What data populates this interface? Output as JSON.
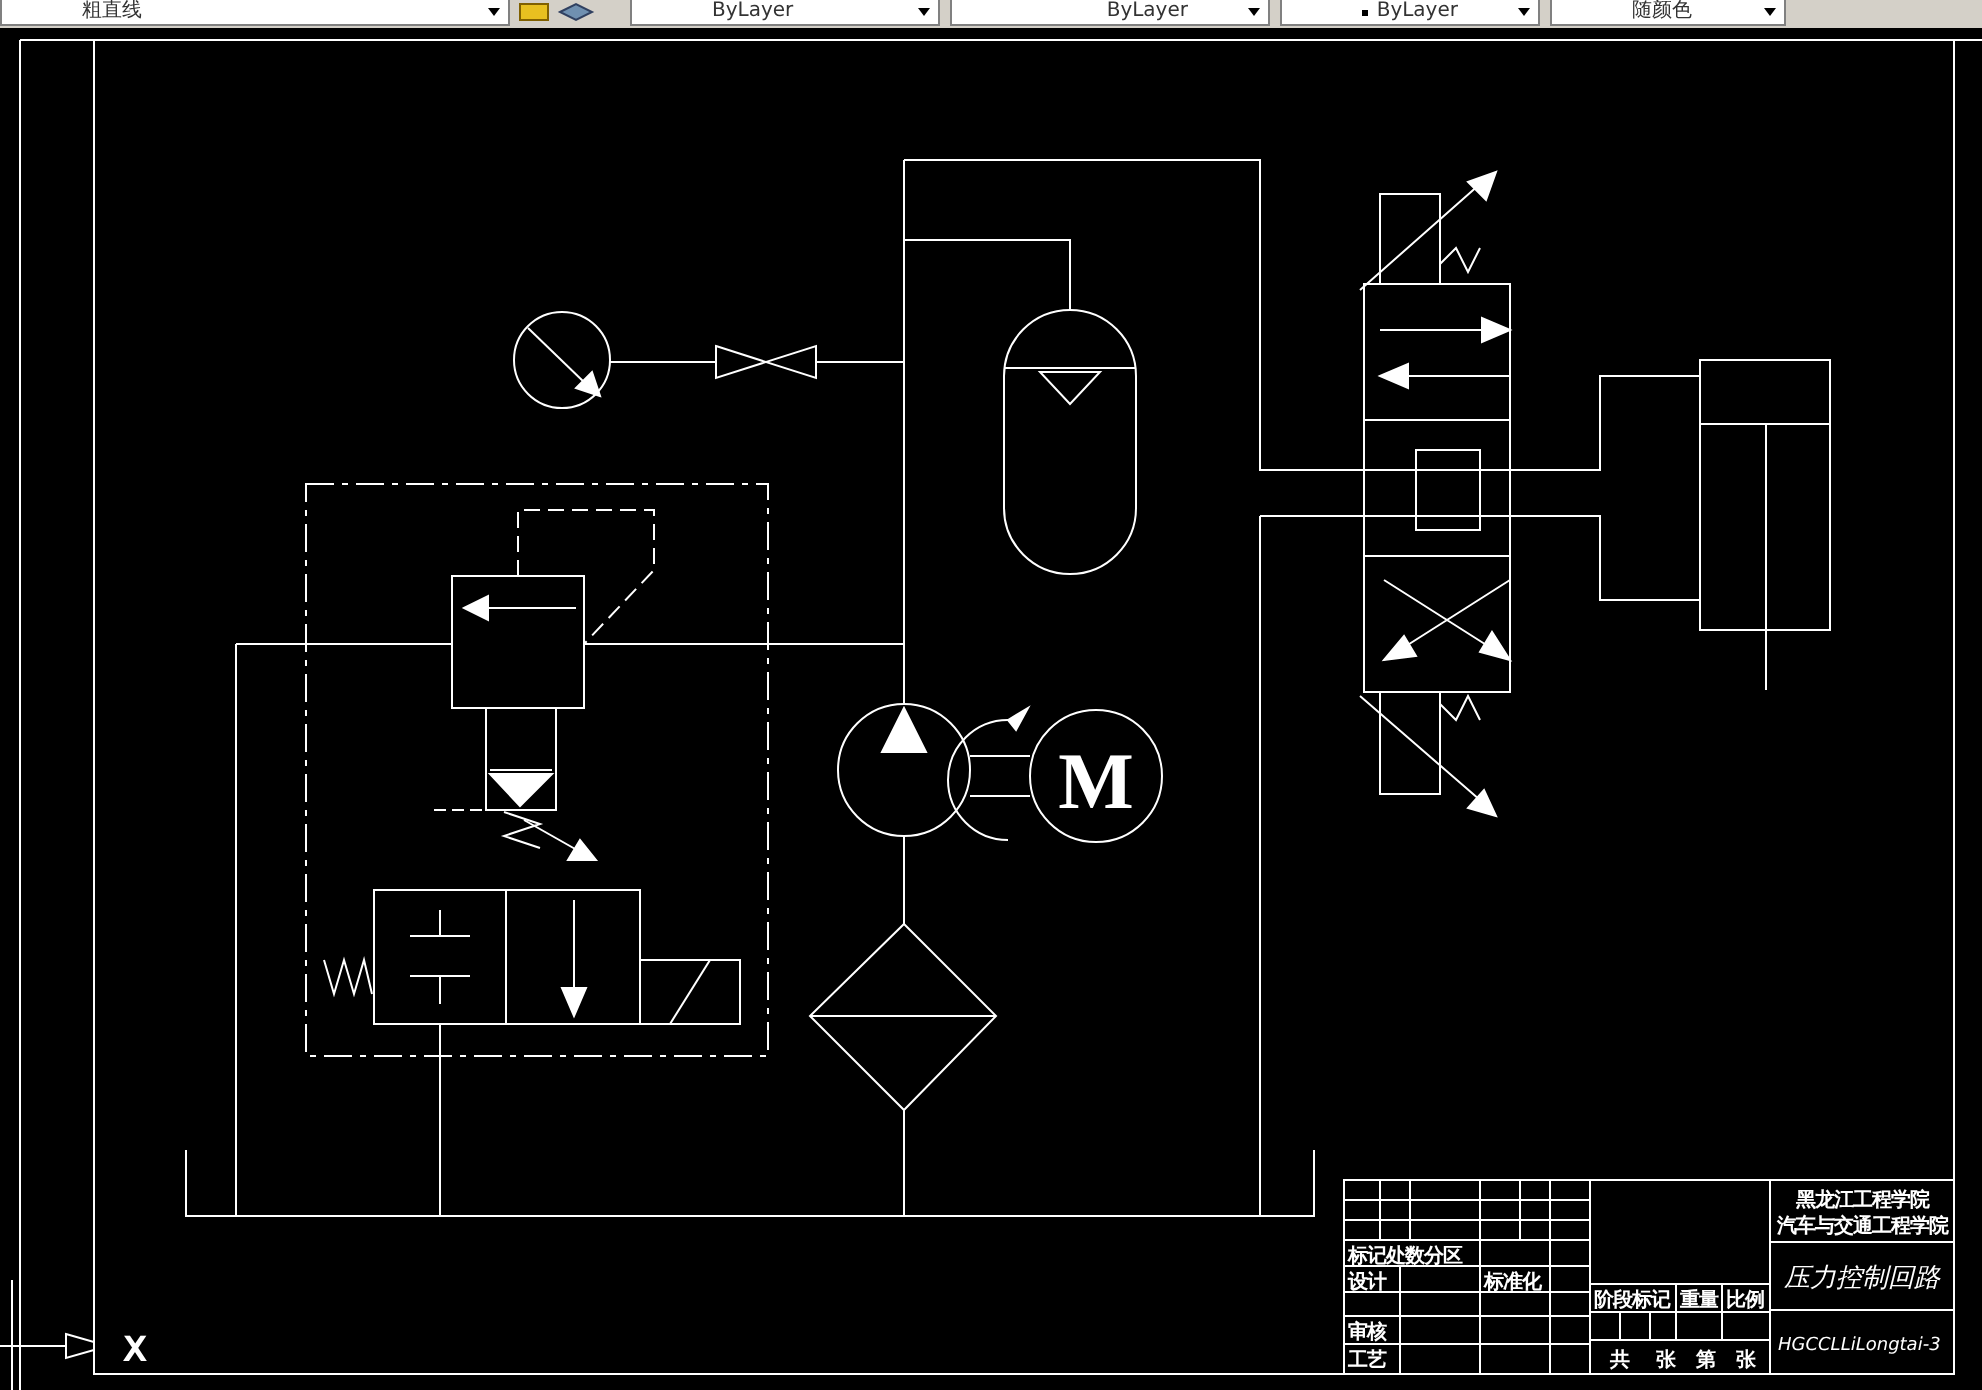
{
  "toolbar": {
    "layer": "粗直线",
    "current_color": "ByLayer",
    "linetype": "ByLayer",
    "lineweight": "ByLayer",
    "plot_style": "随颜色"
  },
  "diagram": {
    "motor_label": "M",
    "axis_label": "X"
  },
  "title_block": {
    "school": "黑龙江工程学院",
    "department": "汽车与交通工程学院",
    "drawing_title": "压力控制回路",
    "drawing_number": "HGCCLLiLongtai-3",
    "labels": [
      "标记处数分区",
      "设计",
      "标准化",
      "阶段标记",
      "重量",
      "比例",
      "审核",
      "工艺",
      "共",
      "张",
      "第",
      "张"
    ]
  }
}
